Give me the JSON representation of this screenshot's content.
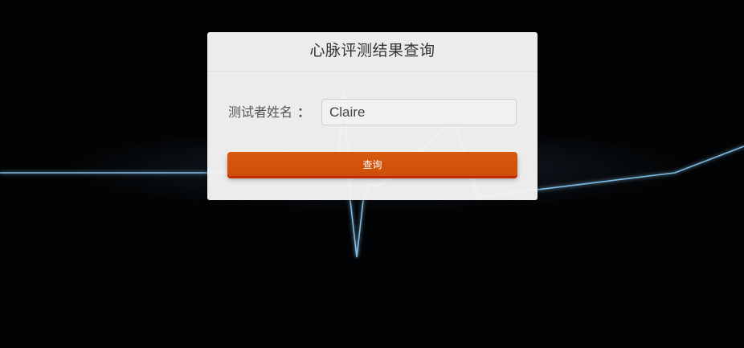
{
  "dialog": {
    "title": "心脉评测结果查询"
  },
  "form": {
    "name_label": "测试者姓名",
    "colon": "：",
    "name_value": "Claire"
  },
  "buttons": {
    "query_label": "查询"
  },
  "colors": {
    "accent": "#d0540a",
    "pulse_line": "#8fd3ff",
    "background": "#020304"
  }
}
